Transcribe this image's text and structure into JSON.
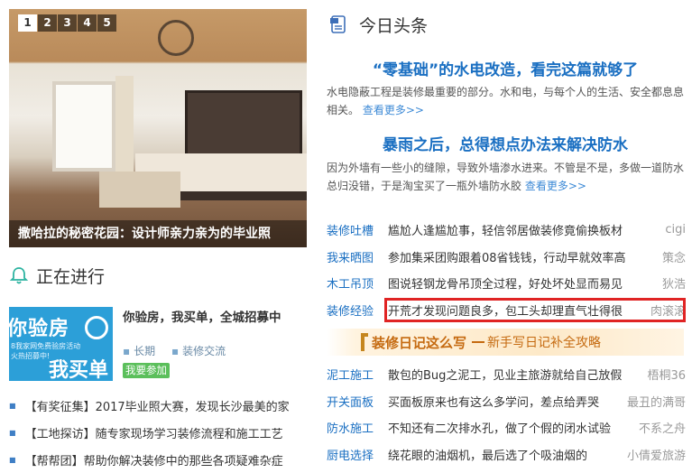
{
  "slideshow": {
    "pages": [
      "1",
      "2",
      "3",
      "4",
      "5"
    ],
    "active_page": "1",
    "caption": "撒哈拉的秘密花园：设计师亲力亲为的毕业照"
  },
  "ongoing": {
    "title": "正在进行",
    "promo": {
      "image_text_1": "你验房",
      "image_text_2": "8我家网免费验房活动",
      "image_text_2b": "火热招募中!",
      "image_text_3": "我买单",
      "title": "你验房，我买单，全城招募中",
      "tag1": "长期",
      "tag2": "装修交流",
      "button": "我要参加"
    },
    "items": [
      "【有奖征集】2017毕业照大赛，发现长沙最美的家",
      "【工地探访】随专家现场学习装修流程和施工工艺",
      "【帮帮团】帮助你解决装修中的那些各项疑难杂症"
    ]
  },
  "today": {
    "title": "今日头条",
    "headline1": "“零基础”的水电改造，看完这篇就够了",
    "summary1": "水电隐蔽工程是装修最重要的部分。水和电，与每个人的生活、安全都息息相关。",
    "headline2": "暴雨之后，总得想点办法来解决防水",
    "summary2": "因为外墙有一些小的缝隙，导致外墙渗水进来。不管是不是，多做一道防水总归没错，于是淘宝买了一瓶外墙防水胶",
    "more": "查看更多>>"
  },
  "list1": [
    {
      "cat": "装修吐槽",
      "text": "尴尬人逢尴尬事，轻信邻居做装修竟偷换板材",
      "author": "cigi"
    },
    {
      "cat": "我来晒图",
      "text": "参加集采团购跟着08省钱钱，行动早就效率高",
      "author": "策念"
    },
    {
      "cat": "木工吊顶",
      "text": "图说轻钢龙骨吊顶全过程，好处坏处显而易见",
      "author": "狄浩"
    },
    {
      "cat": "装修经验",
      "text": "开荒才发现问题良多，包工头却理直气壮得很",
      "author": "肉滚滚"
    }
  ],
  "diary_banner": {
    "title": "装修日记这么写",
    "subtitle": "新手写日记补全攻略"
  },
  "list2": [
    {
      "cat": "泥工施工",
      "text": "散包的Bug之泥工，见业主旅游就给自己放假",
      "author": "梧桐36"
    },
    {
      "cat": "开关面板",
      "text": "买面板原来也有这么多学问，差点给弄哭",
      "author": "最丑的满哥"
    },
    {
      "cat": "防水施工",
      "text": "不知还有二次排水孔，做了个假的闭水试验",
      "author": "不系之舟"
    },
    {
      "cat": "厨电选择",
      "text": "绕花眼的油烟机，最后选了个吸油烟的",
      "author": "小倩爱旅游"
    }
  ]
}
